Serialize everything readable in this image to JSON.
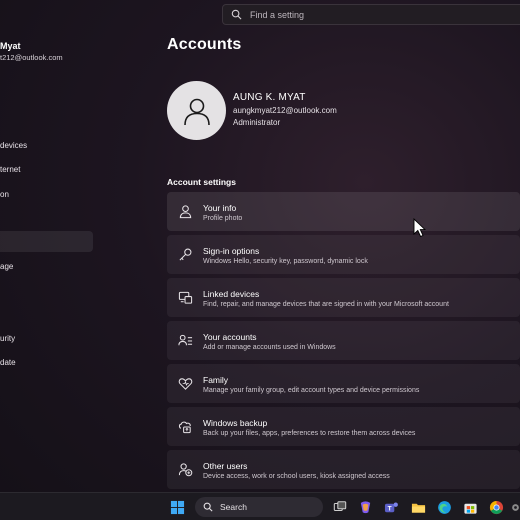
{
  "sidebar": {
    "user_name": "Myat",
    "user_email": "t212@outlook.com",
    "items": [
      "devices",
      "ternet",
      "on",
      "age",
      "urity",
      "date"
    ]
  },
  "search": {
    "placeholder": "Find a setting"
  },
  "page": {
    "title": "Accounts"
  },
  "account": {
    "name": "AUNG K. MYAT",
    "email": "aungkmyat212@outlook.com",
    "role": "Administrator"
  },
  "section": {
    "title": "Account settings"
  },
  "cards": [
    {
      "title": "Your info",
      "subtitle": "Profile photo",
      "icon": "person-icon"
    },
    {
      "title": "Sign-in options",
      "subtitle": "Windows Hello, security key, password, dynamic lock",
      "icon": "key-icon"
    },
    {
      "title": "Linked devices",
      "subtitle": "Find, repair, and manage devices that are signed in with your Microsoft account",
      "icon": "linked-devices-icon"
    },
    {
      "title": "Your accounts",
      "subtitle": "Add or manage accounts used in Windows",
      "icon": "person-list-icon"
    },
    {
      "title": "Family",
      "subtitle": "Manage your family group, edit account types and device permissions",
      "icon": "heart-icon"
    },
    {
      "title": "Windows backup",
      "subtitle": "Back up your files, apps, preferences to restore them across devices",
      "icon": "backup-icon"
    },
    {
      "title": "Other users",
      "subtitle": "Device access, work or school users, kiosk assigned access",
      "icon": "person-add-icon"
    }
  ],
  "taskbar": {
    "search_label": "Search",
    "icons": [
      "windows-start-icon",
      "task-view-icon",
      "copilot-icon",
      "teams-icon",
      "file-explorer-icon",
      "edge-icon",
      "store-icon",
      "chrome-icon",
      "settings-icon"
    ]
  }
}
